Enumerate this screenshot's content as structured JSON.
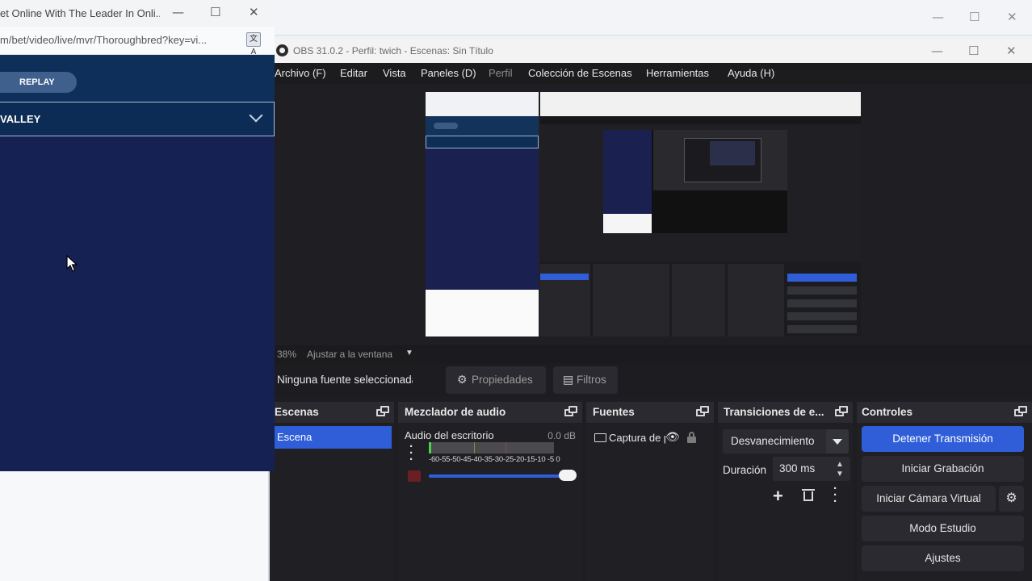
{
  "browser": {
    "title": "et Online With The Leader In Onli...",
    "url": "m/bet/video/live/mvr/Thoroughbred?key=vi...",
    "replay_label": "REPLAY",
    "venue": "VALLEY",
    "controls": {
      "minimize": "—",
      "maximize": "☐",
      "close": "✕"
    },
    "translate_icon": "translate-icon"
  },
  "background_window": {
    "controls": {
      "minimize": "—",
      "maximize": "☐",
      "close": "✕"
    }
  },
  "obs": {
    "window_title": "OBS 31.0.2 - Perfil: twich - Escenas: Sin Título",
    "controls": {
      "minimize": "—",
      "maximize": "☐",
      "close": "✕"
    },
    "menu": [
      "Archivo (F)",
      "Editar",
      "Vista",
      "Paneles (D)",
      "Perfil",
      "Colección de Escenas",
      "Herramientas",
      "Ayuda (H)"
    ],
    "zoom": {
      "percent": "38%",
      "mode": "Ajustar a la ventana"
    },
    "source_bar": {
      "status": "Ninguna fuente seleccionada",
      "properties_label": "Propiedades",
      "filters_label": "Filtros"
    },
    "docks": {
      "scenes": {
        "title": "Escenas",
        "items": [
          "Escena"
        ]
      },
      "mixer": {
        "title": "Mezclador de audio",
        "channel": "Audio del escritorio",
        "level": "0.0 dB",
        "scale": "-60-55-50-45-40-35-30-25-20-15-10 -5  0"
      },
      "sources": {
        "title": "Fuentes",
        "items": [
          "Captura de pantalla"
        ]
      },
      "transitions": {
        "title": "Transiciones de e...",
        "selected": "Desvanecimiento",
        "duration_label": "Duración",
        "duration_value": "300 ms"
      },
      "controls": {
        "title": "Controles",
        "buttons": [
          "Detener Transmisión",
          "Iniciar Grabación",
          "Iniciar Cámara Virtual",
          "Modo Estudio",
          "Ajustes"
        ]
      }
    }
  },
  "colors": {
    "accent": "#2f5ed8",
    "bet_navy": "#152152",
    "obs_bg": "#1e1e22"
  }
}
